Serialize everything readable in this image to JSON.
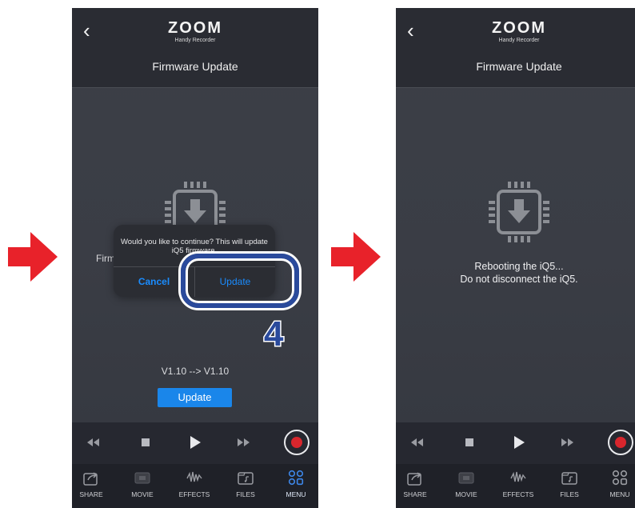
{
  "colors": {
    "arrow": "#e8222a",
    "accent_blue": "#1a86ea",
    "callout": "#2a4a9c",
    "record_red": "#d8262d"
  },
  "icons": {
    "back": "chevron-left-icon",
    "chip": "firmware-chip-download-icon",
    "rewind": "rewind-icon",
    "stop": "stop-icon",
    "play": "play-icon",
    "fast_forward": "fast-forward-icon",
    "record": "record-icon",
    "share": "share-icon",
    "movie": "movie-icon",
    "effects": "effects-icon",
    "files": "files-icon",
    "menu": "menu-grid-icon"
  },
  "left_screen": {
    "header": {
      "logo": "ZOOM",
      "logo_sub": "Handy Recorder",
      "back_glyph": "‹"
    },
    "title": "Firmware Update",
    "partial_text": "Firm",
    "dialog": {
      "message": "Would you like to continue? This will update iQ5 firmware.",
      "cancel_label": "Cancel",
      "update_label": "Update"
    },
    "callout_number": "4",
    "version_text": "V1.10 --> V1.10",
    "update_button_label": "Update",
    "tabs": [
      {
        "label": "SHARE"
      },
      {
        "label": "MOVIE"
      },
      {
        "label": "EFFECTS"
      },
      {
        "label": "FILES"
      },
      {
        "label": "MENU",
        "active": true
      }
    ]
  },
  "right_screen": {
    "header": {
      "logo": "ZOOM",
      "logo_sub": "Handy Recorder",
      "back_glyph": "‹"
    },
    "title": "Firmware Update",
    "status_line1": "Rebooting the iQ5...",
    "status_line2": "Do not disconnect the iQ5.",
    "tabs": [
      {
        "label": "SHARE"
      },
      {
        "label": "MOVIE"
      },
      {
        "label": "EFFECTS"
      },
      {
        "label": "FILES"
      },
      {
        "label": "MENU"
      }
    ]
  }
}
